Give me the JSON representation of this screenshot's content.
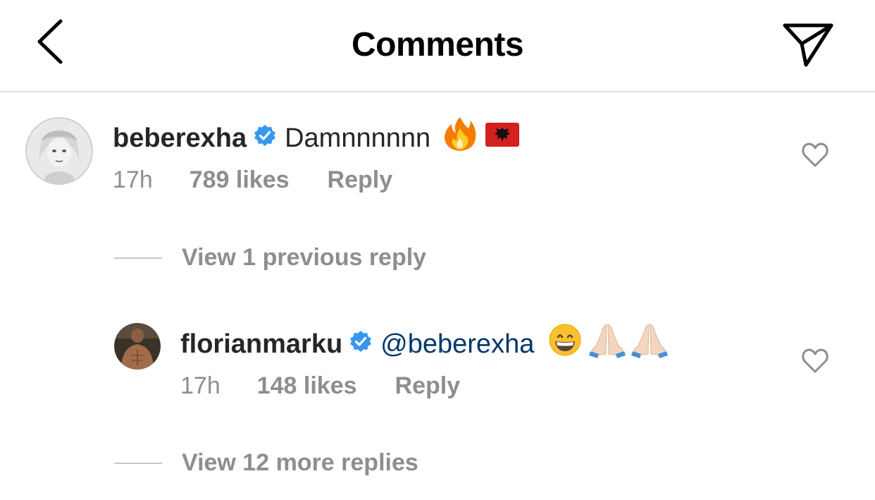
{
  "header": {
    "title": "Comments",
    "back_icon": "chevron-left-icon",
    "share_icon": "paper-plane-icon"
  },
  "comments": [
    {
      "username": "beberexha",
      "verified": true,
      "text": "Damnnnnnn",
      "emojis": [
        "fire",
        "albania-flag"
      ],
      "time": "17h",
      "likes": "789 likes",
      "reply_label": "Reply",
      "view_replies_label": "View 1 previous reply"
    },
    {
      "username": "florianmarku",
      "verified": true,
      "mention": "@beberexha",
      "emojis": [
        "grinning-face",
        "folded-hands",
        "folded-hands"
      ],
      "time": "17h",
      "likes": "148 likes",
      "reply_label": "Reply",
      "view_replies_label": "View 12 more replies"
    }
  ],
  "colors": {
    "verified_badge": "#3897f0",
    "mention": "#00376b",
    "secondary_text": "#8e8e8e",
    "divider": "#dbdbdb"
  }
}
